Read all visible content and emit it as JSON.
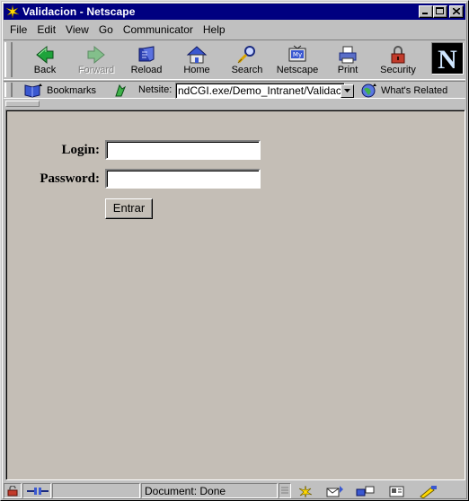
{
  "window": {
    "title": "Validacion - Netscape",
    "minimize_glyph": "_",
    "maximize_glyph": "□",
    "close_glyph": "✕"
  },
  "menu": [
    {
      "label": "File"
    },
    {
      "label": "Edit"
    },
    {
      "label": "View"
    },
    {
      "label": "Go"
    },
    {
      "label": "Communicator"
    },
    {
      "label": "Help"
    }
  ],
  "toolbar": {
    "buttons": [
      {
        "label": "Back",
        "icon": "back-arrow-icon",
        "enabled": true
      },
      {
        "label": "Forward",
        "icon": "forward-arrow-icon",
        "enabled": false
      },
      {
        "label": "Reload",
        "icon": "reload-icon",
        "enabled": true
      },
      {
        "label": "Home",
        "icon": "home-icon",
        "enabled": true
      },
      {
        "label": "Search",
        "icon": "search-icon",
        "enabled": true
      },
      {
        "label": "Netscape",
        "icon": "my-netscape-icon",
        "enabled": true
      },
      {
        "label": "Print",
        "icon": "printer-icon",
        "enabled": true
      },
      {
        "label": "Security",
        "icon": "padlock-icon",
        "enabled": true
      }
    ],
    "logo_letter": "N"
  },
  "location": {
    "bookmarks_label": "Bookmarks",
    "netsite_label": "Netsite:",
    "url": "ndCGI.exe/Demo_Intranet/Validacion",
    "related_label": "What's Related"
  },
  "form": {
    "login_label": "Login:",
    "login_value": "",
    "password_label": "Password:",
    "password_value": "",
    "submit_label": "Entrar"
  },
  "status": {
    "text": "Document: Done"
  },
  "colors": {
    "titlebar": "#000080",
    "chrome": "#c0c0c0",
    "page_background": "#c4beb6"
  }
}
